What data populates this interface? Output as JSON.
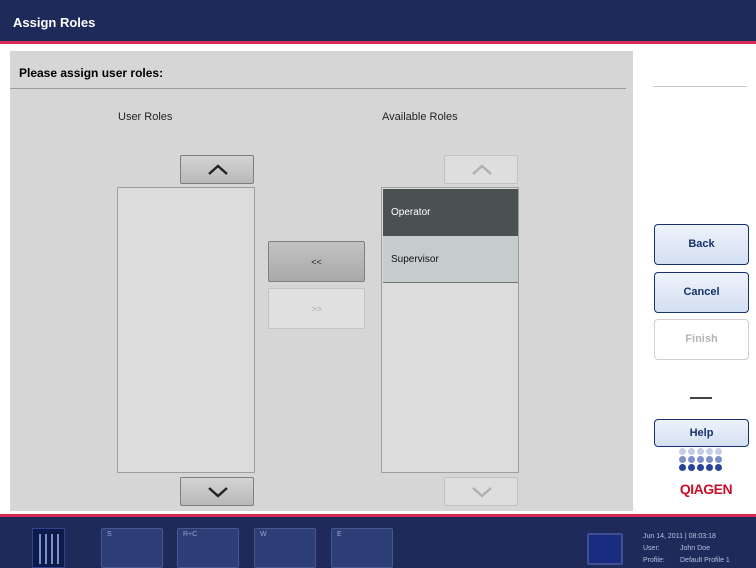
{
  "window": {
    "title": "Assign Roles"
  },
  "main": {
    "heading": "Please assign user roles:",
    "user_roles": {
      "label": "User Roles",
      "items": []
    },
    "available_roles": {
      "label": "Available Roles",
      "items": [
        {
          "label": "Operator",
          "selected": true
        },
        {
          "label": "Supervisor",
          "selected": false
        }
      ]
    },
    "buttons": {
      "move_left": "<<",
      "move_right": ">>"
    }
  },
  "sidebar": {
    "back": "Back",
    "cancel": "Cancel",
    "finish": "Finish",
    "help": "Help",
    "logo_text": "QIAGEN"
  },
  "footer": {
    "tiles": [
      "S",
      "R+C",
      "W",
      "E"
    ],
    "datetime": "Jun 14, 2011 | 08:03:18",
    "user_label": "User:",
    "user_value": "John Doe",
    "profile_label": "Profile:",
    "profile_value": "Default Profile 1"
  },
  "colors": {
    "header_bg": "#1d2a5a",
    "accent": "#d62a55",
    "selected_item": "#4b5152",
    "button_text": "#17306e",
    "logo": "#c8102e"
  }
}
